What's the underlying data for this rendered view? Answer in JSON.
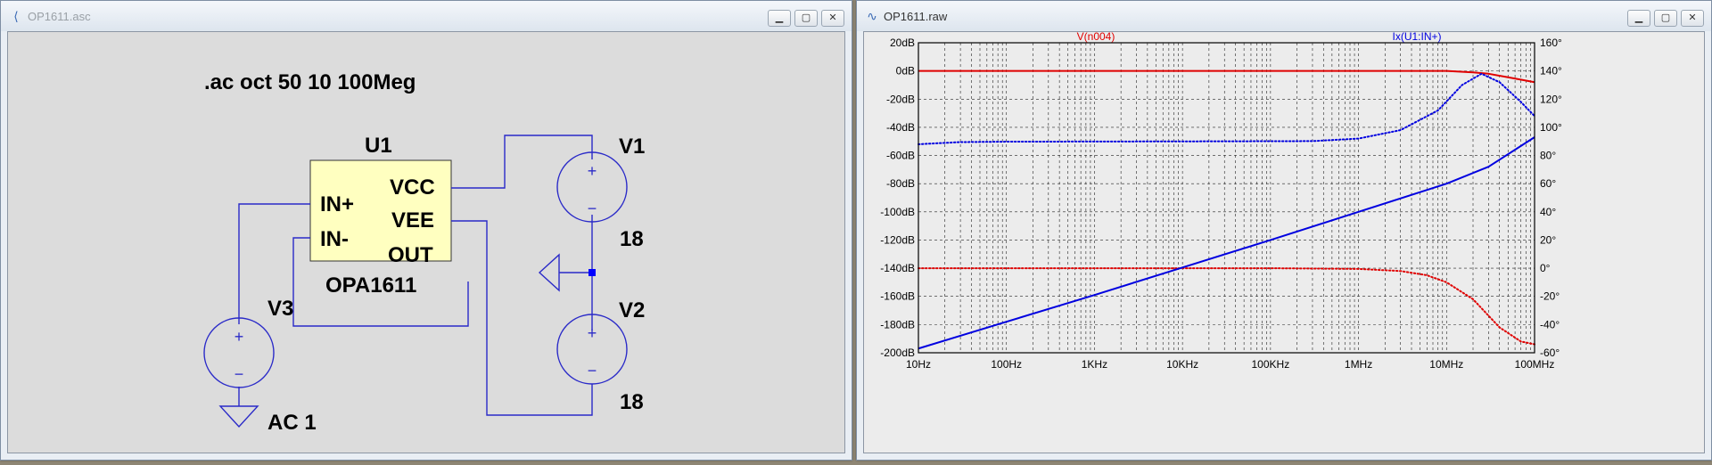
{
  "schematic_window": {
    "title": "OP1611.asc",
    "icon": "ltspice-schematic-icon",
    "buttons": [
      "minimize",
      "maximize",
      "close"
    ],
    "directive": ".ac oct 50 10 100Meg",
    "opamp": {
      "ref": "U1",
      "model": "OPA1611",
      "pins": [
        "IN+",
        "IN-",
        "VCC",
        "VEE",
        "OUT"
      ]
    },
    "sources": [
      {
        "ref": "V1",
        "value": "18"
      },
      {
        "ref": "V2",
        "value": "18"
      },
      {
        "ref": "V3",
        "value": "AC 1"
      }
    ]
  },
  "plot_window": {
    "title": "OP1611.raw",
    "icon": "waveform-icon",
    "buttons": [
      "minimize",
      "maximize",
      "close"
    ],
    "colors": {
      "red": "#e00000",
      "blue": "#0000e0"
    }
  },
  "chart_data": {
    "type": "line",
    "x_scale": "log",
    "xlim": [
      10,
      100000000
    ],
    "x_ticks": [
      "10Hz",
      "100Hz",
      "1KHz",
      "10KHz",
      "100KHz",
      "1MHz",
      "10MHz",
      "100MHz"
    ],
    "left_axis": {
      "ylim": [
        -200,
        20
      ],
      "ticks": [
        "20dB",
        "0dB",
        "-20dB",
        "-40dB",
        "-60dB",
        "-80dB",
        "-100dB",
        "-120dB",
        "-140dB",
        "-160dB",
        "-180dB",
        "-200dB"
      ]
    },
    "right_axis": {
      "ylim": [
        -60,
        160
      ],
      "ticks": [
        "160°",
        "140°",
        "120°",
        "100°",
        "80°",
        "60°",
        "40°",
        "20°",
        "0°",
        "-20°",
        "-40°",
        "-60°"
      ]
    },
    "grid": true,
    "series": [
      {
        "name": "V(n004)",
        "color": "#e00000",
        "quantity": "magnitude",
        "axis": "left",
        "style": "solid",
        "points": [
          [
            10,
            0
          ],
          [
            1000000,
            0
          ],
          [
            5000000,
            0
          ],
          [
            10000000,
            0
          ],
          [
            20000000,
            -1
          ],
          [
            30000000,
            -2
          ],
          [
            50000000,
            -4.5
          ],
          [
            100000000,
            -8
          ]
        ]
      },
      {
        "name": "V(n004)",
        "color": "#e00000",
        "quantity": "phase",
        "axis": "right",
        "style": "dotted",
        "points": [
          [
            10,
            0
          ],
          [
            100000,
            0
          ],
          [
            1000000,
            -0.5
          ],
          [
            3000000,
            -2
          ],
          [
            6000000,
            -5
          ],
          [
            10000000,
            -10
          ],
          [
            20000000,
            -22
          ],
          [
            40000000,
            -42
          ],
          [
            70000000,
            -52
          ],
          [
            100000000,
            -54
          ]
        ]
      },
      {
        "name": "Ix(U1:IN+)",
        "color": "#0000e0",
        "quantity": "magnitude",
        "axis": "left",
        "style": "solid",
        "points": [
          [
            10,
            -197
          ],
          [
            100,
            -178
          ],
          [
            1000,
            -159
          ],
          [
            10000,
            -139.5
          ],
          [
            100000,
            -120
          ],
          [
            1000000,
            -100
          ],
          [
            10000000,
            -80
          ],
          [
            30000000,
            -68
          ],
          [
            100000000,
            -47
          ]
        ]
      },
      {
        "name": "Ix(U1:IN+)",
        "color": "#0000e0",
        "quantity": "phase",
        "axis": "right",
        "style": "dotted",
        "points": [
          [
            10,
            88
          ],
          [
            30,
            89.5
          ],
          [
            100,
            89.8
          ],
          [
            10000,
            90
          ],
          [
            300000,
            90.2
          ],
          [
            1000000,
            92
          ],
          [
            3000000,
            98
          ],
          [
            8000000,
            112
          ],
          [
            15000000,
            130
          ],
          [
            25000000,
            138
          ],
          [
            40000000,
            132
          ],
          [
            70000000,
            118
          ],
          [
            100000000,
            108
          ]
        ]
      }
    ]
  }
}
